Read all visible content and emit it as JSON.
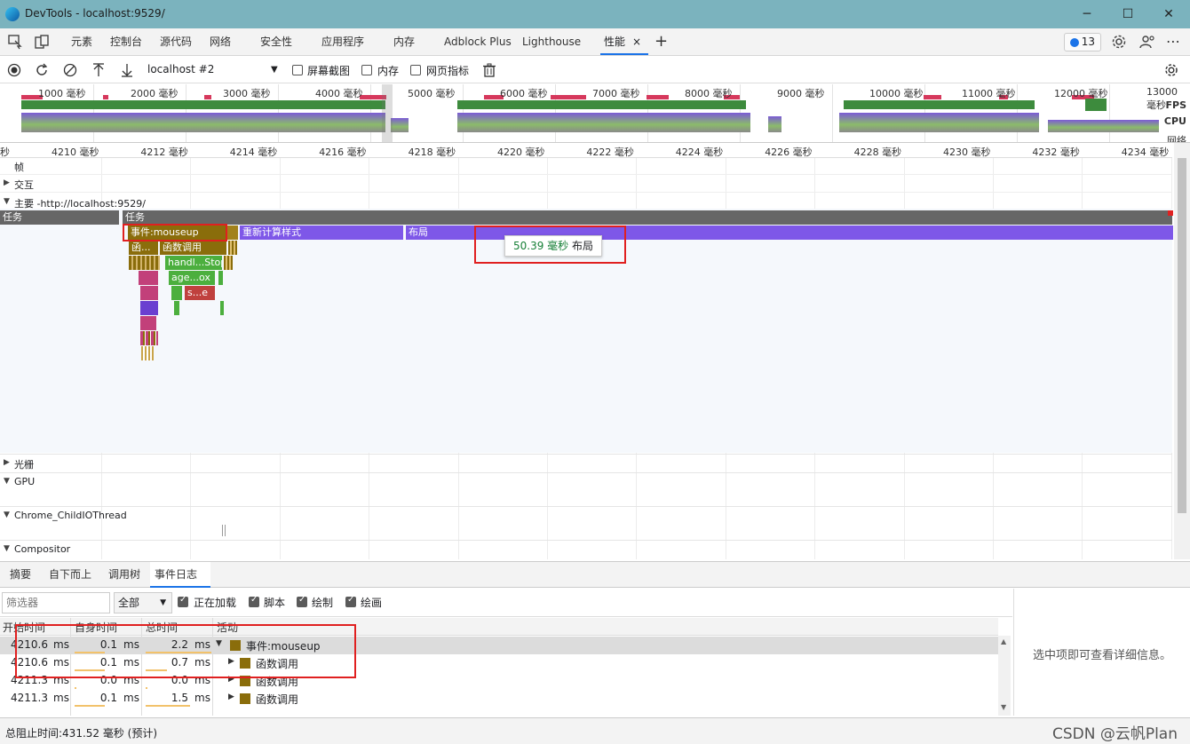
{
  "window": {
    "title": "DevTools - localhost:9529/",
    "minimize": "─",
    "maximize": "☐",
    "close": "✕"
  },
  "tabs": [
    "元素",
    "控制台",
    "源代码",
    "网络",
    "安全性",
    "应用程序",
    "内存",
    "Adblock Plus",
    "Lighthouse",
    "性能"
  ],
  "active_tab_close": "×",
  "add_tab": "+",
  "issues_count": "13",
  "more_menu": "⋯",
  "perf_toolbar": {
    "target": "localhost #2",
    "screenshots": "屏幕截图",
    "memory": "内存",
    "web_vitals": "网页指标"
  },
  "overview": {
    "ticks": [
      "1000 毫秒",
      "2000 毫秒",
      "3000 毫秒",
      "4000 毫秒",
      "5000 毫秒",
      "6000 毫秒",
      "7000 毫秒",
      "8000 毫秒",
      "9000 毫秒",
      "10000 毫秒",
      "11000 毫秒",
      "12000 毫秒",
      "13000 毫秒"
    ],
    "fps_label": "FPS",
    "cpu_label": "CPU",
    "net_label": "网络"
  },
  "ruler": {
    "left_stub": "秒",
    "ticks": [
      "4210 毫秒",
      "4212 毫秒",
      "4214 毫秒",
      "4216 毫秒",
      "4218 毫秒",
      "4220 毫秒",
      "4222 毫秒",
      "4224 毫秒",
      "4226 毫秒",
      "4228 毫秒",
      "4230 毫秒",
      "4232 毫秒",
      "4234 毫秒"
    ]
  },
  "tracks": {
    "frames": "帧",
    "interactions": "交互",
    "main": "主要 -http://localhost:9529/",
    "raster": "光栅",
    "gpu": "GPU",
    "child_io": "Chrome_ChildIOThread",
    "compositor": "Compositor"
  },
  "flame": {
    "task_left": "任务",
    "task_main": "任务",
    "event": "事件:mouseup",
    "recalc": "重新计算样式",
    "layout": "布局",
    "fn_short": "函...",
    "fn_call": "函数调用",
    "handler": "handl...Stop",
    "age": "age...ox",
    "se": "s...e"
  },
  "tooltip": {
    "ms": "50.39 毫秒",
    "label": "布局"
  },
  "bottom_tabs": [
    "摘要",
    "自下而上",
    "调用树",
    "事件日志"
  ],
  "filter": {
    "placeholder": "筛选器",
    "select": "全部",
    "loading": "正在加载",
    "scripting": "脚本",
    "rendering": "绘制",
    "painting": "绘画"
  },
  "table": {
    "headers": [
      "开始时间",
      "自身时间",
      "总时间",
      "活动"
    ],
    "rows": [
      {
        "start": "4210.6",
        "self": "0.1",
        "total": "2.2",
        "activity": "事件:mouseup",
        "expanded": true
      },
      {
        "start": "4210.6",
        "self": "0.1",
        "total": "0.7",
        "activity": "函数调用",
        "expanded": false
      },
      {
        "start": "4211.3",
        "self": "0.0",
        "total": "0.0",
        "activity": "函数调用",
        "expanded": false
      },
      {
        "start": "4211.3",
        "self": "0.1",
        "total": "1.5",
        "activity": "函数调用",
        "expanded": false
      }
    ],
    "unit": "ms"
  },
  "detail_hint": "选中项即可查看详细信息。",
  "status": "总阻止时间:431.52 毫秒 (预计)",
  "watermark": "CSDN @云帆Plan",
  "colors": {
    "accent": "#1a73e8",
    "task": "#666666",
    "event": "#8a6d0b",
    "layout": "#7e57e8",
    "script": "#4caf3e",
    "titlebar": "#7bb3be"
  }
}
